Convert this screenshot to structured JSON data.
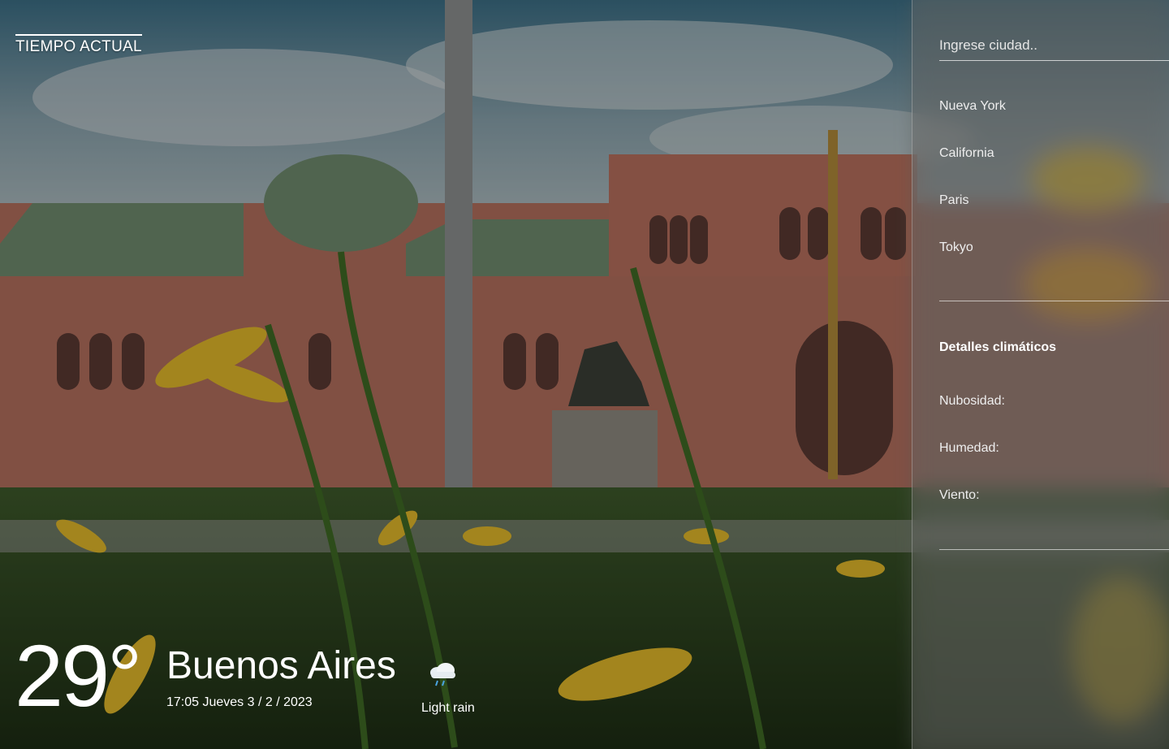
{
  "app": {
    "logo": "TIEMPO ACTUAL"
  },
  "weather": {
    "temperature": "29°",
    "city": "Buenos Aires",
    "datetime": "17:05 Jueves 3 / 2 / 2023",
    "condition": "Light rain",
    "condition_icon": "rain-cloud-icon"
  },
  "panel": {
    "search_placeholder": "Ingrese ciudad..",
    "cities": [
      "Nueva York",
      "California",
      "Paris",
      "Tokyo"
    ],
    "details_title": "Detalles climáticos",
    "details": {
      "cloudiness_label": "Nubosidad:",
      "humidity_label": "Humedad:",
      "wind_label": "Viento:"
    }
  }
}
